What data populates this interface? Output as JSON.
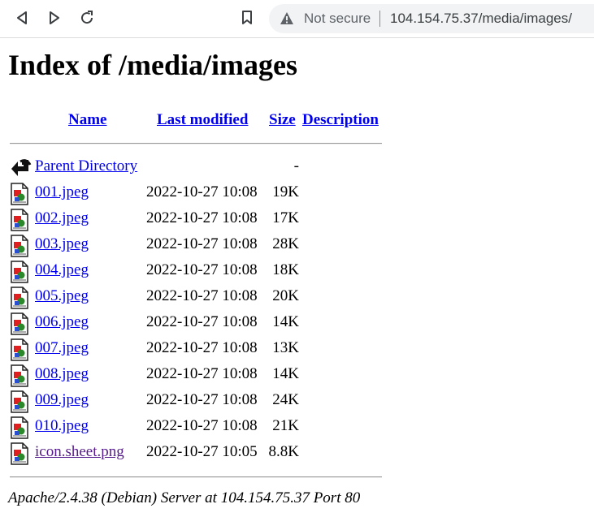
{
  "browser": {
    "security_label": "Not secure",
    "url": "104.154.75.37/media/images/"
  },
  "page": {
    "title": "Index of /media/images",
    "columns": {
      "name": "Name",
      "last_modified": "Last modified",
      "size": "Size",
      "description": "Description"
    },
    "parent": {
      "name": "Parent Directory",
      "size": "-",
      "icon": "back-icon"
    },
    "files": [
      {
        "name": "001.jpeg",
        "modified": "2022-10-27 10:08",
        "size": "19K",
        "icon": "image-file-icon"
      },
      {
        "name": "002.jpeg",
        "modified": "2022-10-27 10:08",
        "size": "17K",
        "icon": "image-file-icon"
      },
      {
        "name": "003.jpeg",
        "modified": "2022-10-27 10:08",
        "size": "28K",
        "icon": "image-file-icon"
      },
      {
        "name": "004.jpeg",
        "modified": "2022-10-27 10:08",
        "size": "18K",
        "icon": "image-file-icon"
      },
      {
        "name": "005.jpeg",
        "modified": "2022-10-27 10:08",
        "size": "20K",
        "icon": "image-file-icon"
      },
      {
        "name": "006.jpeg",
        "modified": "2022-10-27 10:08",
        "size": "14K",
        "icon": "image-file-icon"
      },
      {
        "name": "007.jpeg",
        "modified": "2022-10-27 10:08",
        "size": "13K",
        "icon": "image-file-icon"
      },
      {
        "name": "008.jpeg",
        "modified": "2022-10-27 10:08",
        "size": "14K",
        "icon": "image-file-icon"
      },
      {
        "name": "009.jpeg",
        "modified": "2022-10-27 10:08",
        "size": "24K",
        "icon": "image-file-icon"
      },
      {
        "name": "010.jpeg",
        "modified": "2022-10-27 10:08",
        "size": "21K",
        "icon": "image-file-icon"
      },
      {
        "name": "icon.sheet.png",
        "modified": "2022-10-27 10:05",
        "size": "8.8K",
        "icon": "image-file-icon",
        "visited": true
      }
    ],
    "footer": "Apache/2.4.38 (Debian) Server at 104.154.75.37 Port 80"
  },
  "colors": {
    "link": "#0000ee",
    "visited_link": "#551a8b",
    "omnibox_bg": "#f1f3f4"
  }
}
